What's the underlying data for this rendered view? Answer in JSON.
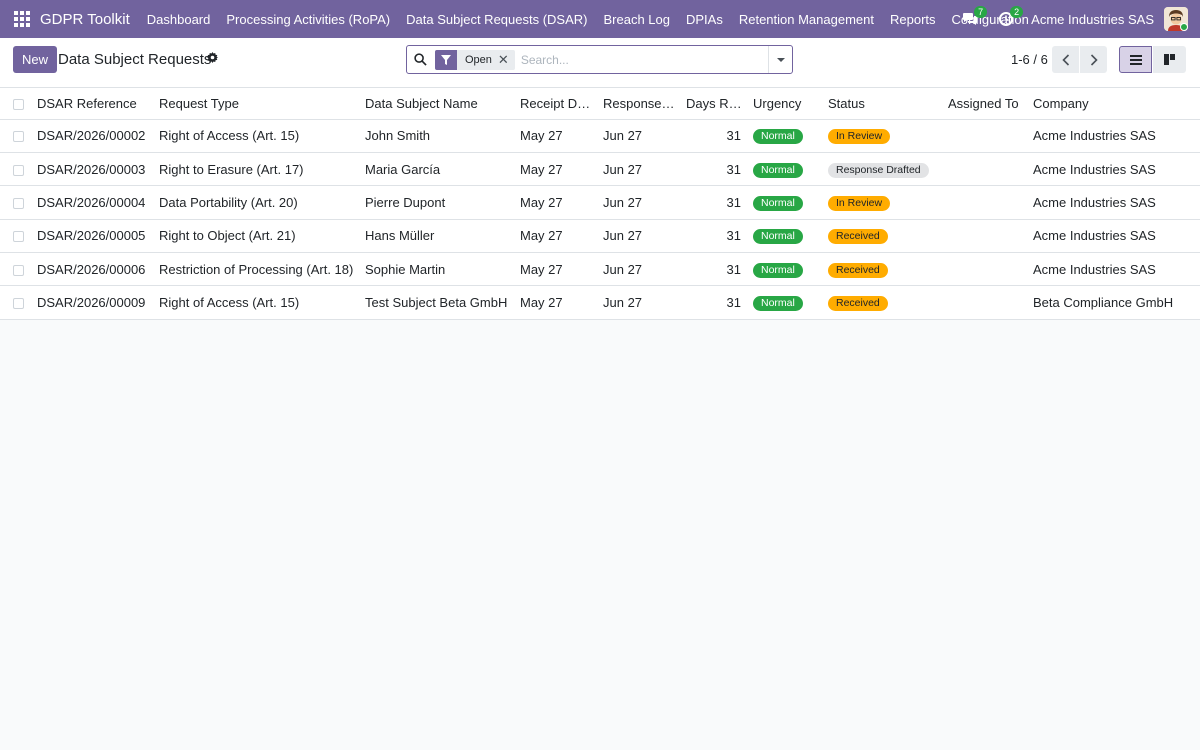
{
  "navbar": {
    "brand": "GDPR Toolkit",
    "menu": [
      "Dashboard",
      "Processing Activities (RoPA)",
      "Data Subject Requests (DSAR)",
      "Breach Log",
      "DPIAs",
      "Retention Management",
      "Reports",
      "Configuration"
    ],
    "messages_count": "7",
    "activities_count": "2",
    "company": "Acme Industries SAS"
  },
  "control": {
    "new_label": "New",
    "title": "Data Subject Requests",
    "facet_value": "Open",
    "search_placeholder": "Search...",
    "pager": "1-6 / 6"
  },
  "table": {
    "columns": [
      "DSAR Reference",
      "Request Type",
      "Data Subject Name",
      "Receipt Date",
      "Response …",
      "Days Re…",
      "Urgency",
      "Status",
      "Assigned To",
      "Company"
    ],
    "rows": [
      {
        "ref": "DSAR/2026/00002",
        "type": "Right of Access (Art. 15)",
        "subject": "John Smith",
        "receipt": "May 27",
        "response": "Jun 27",
        "days": "31",
        "urgency": "Normal",
        "status": "In Review",
        "assigned": "",
        "company": "Acme Industries SAS"
      },
      {
        "ref": "DSAR/2026/00003",
        "type": "Right to Erasure (Art. 17)",
        "subject": "Maria García",
        "receipt": "May 27",
        "response": "Jun 27",
        "days": "31",
        "urgency": "Normal",
        "status": "Response Drafted",
        "assigned": "",
        "company": "Acme Industries SAS"
      },
      {
        "ref": "DSAR/2026/00004",
        "type": "Data Portability (Art. 20)",
        "subject": "Pierre Dupont",
        "receipt": "May 27",
        "response": "Jun 27",
        "days": "31",
        "urgency": "Normal",
        "status": "In Review",
        "assigned": "",
        "company": "Acme Industries SAS"
      },
      {
        "ref": "DSAR/2026/00005",
        "type": "Right to Object (Art. 21)",
        "subject": "Hans Müller",
        "receipt": "May 27",
        "response": "Jun 27",
        "days": "31",
        "urgency": "Normal",
        "status": "Received",
        "assigned": "",
        "company": "Acme Industries SAS"
      },
      {
        "ref": "DSAR/2026/00006",
        "type": "Restriction of Processing (Art. 18)",
        "subject": "Sophie Martin",
        "receipt": "May 27",
        "response": "Jun 27",
        "days": "31",
        "urgency": "Normal",
        "status": "Received",
        "assigned": "",
        "company": "Acme Industries SAS"
      },
      {
        "ref": "DSAR/2026/00009",
        "type": "Right of Access (Art. 15)",
        "subject": "Test Subject Beta GmbH",
        "receipt": "May 27",
        "response": "Jun 27",
        "days": "31",
        "urgency": "Normal",
        "status": "Received",
        "assigned": "",
        "company": "Beta Compliance GmbH"
      }
    ]
  },
  "colors": {
    "brand": "#71639e",
    "success": "#28a745",
    "warning": "#ffac00",
    "neutral": "#e2e3e5"
  },
  "icons": [
    "apps-grid-icon",
    "chat-icon",
    "clock-activity-icon",
    "gear-icon",
    "search-icon",
    "filter-icon",
    "close-icon",
    "chevron-left-icon",
    "chevron-right-icon",
    "list-view-icon",
    "kanban-view-icon"
  ]
}
